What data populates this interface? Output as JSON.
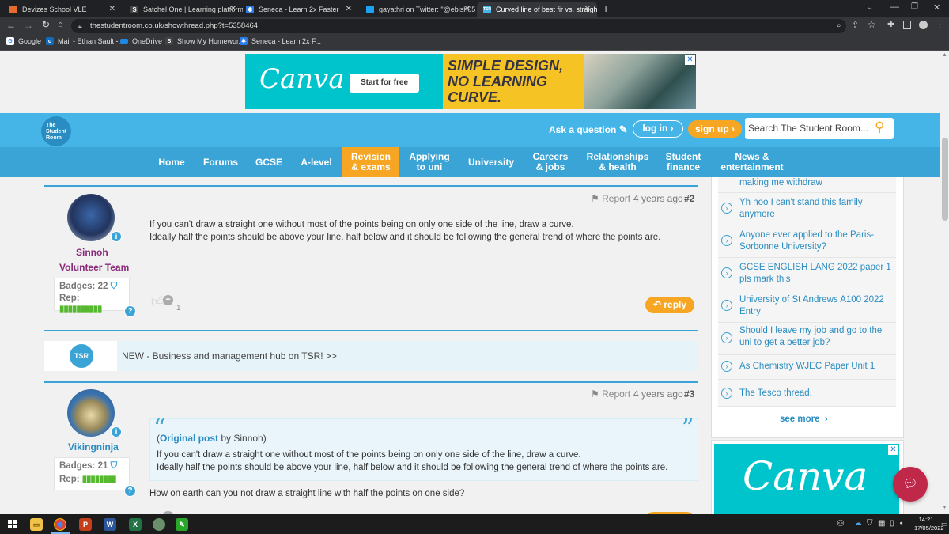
{
  "browser": {
    "tabs": [
      {
        "title": "Devizes School VLE",
        "fav": "",
        "color": "#e66b2d"
      },
      {
        "title": "Satchel One | Learning platform",
        "fav": "S",
        "color": "#333"
      },
      {
        "title": "Seneca - Learn 2x Faster",
        "fav": "✱",
        "color": "#2d7be6"
      },
      {
        "title": "gayathri on Twitter: \"@ebish05 y",
        "fav": "🐦",
        "color": "#1da1f2"
      },
      {
        "title": "Curved line of best fir vs. straigh",
        "fav": "TSR",
        "color": "#45b5e8"
      }
    ],
    "new_tab": "+",
    "url": "thestudentroom.co.uk/showthread.php?t=5358464",
    "bookmarks": [
      {
        "label": "Google",
        "icon": "google-icon"
      },
      {
        "label": "Mail - Ethan Sault -...",
        "icon": "outlook-icon"
      },
      {
        "label": "OneDrive",
        "icon": "onedrive-icon"
      },
      {
        "label": "Show My Homewor...",
        "icon": "satchel-icon"
      },
      {
        "label": "Seneca - Learn 2x F...",
        "icon": "seneca-icon"
      }
    ]
  },
  "ad_top": {
    "brand": "Canva",
    "cta": "Start for free",
    "line1": "SIMPLE DESIGN,",
    "line2": "NO LEARNING",
    "line3": "CURVE."
  },
  "header": {
    "logo_lines": [
      "The",
      "Student",
      "Room"
    ],
    "ask": "Ask a question",
    "login": "log in",
    "signup": "sign up",
    "search_placeholder": "Search The Student Room..."
  },
  "nav": [
    {
      "label": "Home"
    },
    {
      "label": "Forums"
    },
    {
      "label": "GCSE"
    },
    {
      "label": "A-level"
    },
    {
      "label": "Revision\n& exams",
      "active": true
    },
    {
      "label": "Applying\nto uni"
    },
    {
      "label": "University"
    },
    {
      "label": "Careers\n& jobs"
    },
    {
      "label": "Relationships\n& health"
    },
    {
      "label": "Student\nfinance"
    },
    {
      "label": "News &\nentertainment"
    }
  ],
  "post2": {
    "user": "Sinnoh",
    "role": "Volunteer Team",
    "badges": "Badges: 22",
    "rep": "Rep:",
    "report": "Report",
    "time": "4 years ago",
    "num": "#2",
    "line1": "If you can't draw a straight one without most of the points being on only one side of the line, draw a curve.",
    "line2": "Ideally half the points should be above your line, half below and it should be following the general trend of where the points are.",
    "likes": "1",
    "reply": "reply"
  },
  "promo": {
    "logo": "TSR",
    "text": "NEW - Business and management hub on TSR! >>"
  },
  "post3": {
    "user": "Vikingninja",
    "badges": "Badges: 21",
    "rep": "Rep:",
    "report": "Report",
    "time": "4 years ago",
    "num": "#3",
    "quote_open": "“",
    "quote_close": "”",
    "quote_prefix": "(",
    "quote_link": "Original post",
    "quote_by": " by ",
    "quote_user": "Sinnoh",
    "quote_suffix": ")",
    "quote_line1": "If you can't draw a straight one without most of the points being on only one side of the line, draw a curve.",
    "quote_line2": "Ideally half the points should be above your line, half below and it should be following the general trend of where the points are.",
    "body": "How on earth can you not draw a straight line with half the points on one side?"
  },
  "sidebar": {
    "items": [
      {
        "text": "making me withdraw"
      },
      {
        "text": "Yh noo I can't stand this family anymore"
      },
      {
        "text": "Anyone ever applied to the Paris-Sorbonne University?"
      },
      {
        "text": "GCSE ENGLISH LANG 2022 paper 1 pls mark this"
      },
      {
        "text": "University of St Andrews A100 2022 Entry"
      },
      {
        "text": "Should I leave my job and go to the uni to get a better job?"
      },
      {
        "text": "As Chemistry WJEC Paper Unit 1"
      },
      {
        "text": "The Tesco thread."
      }
    ],
    "see_more": "see more"
  },
  "ad_side": {
    "brand": "Canva"
  },
  "taskbar": {
    "time": "14:21",
    "date": "17/05/2022"
  }
}
